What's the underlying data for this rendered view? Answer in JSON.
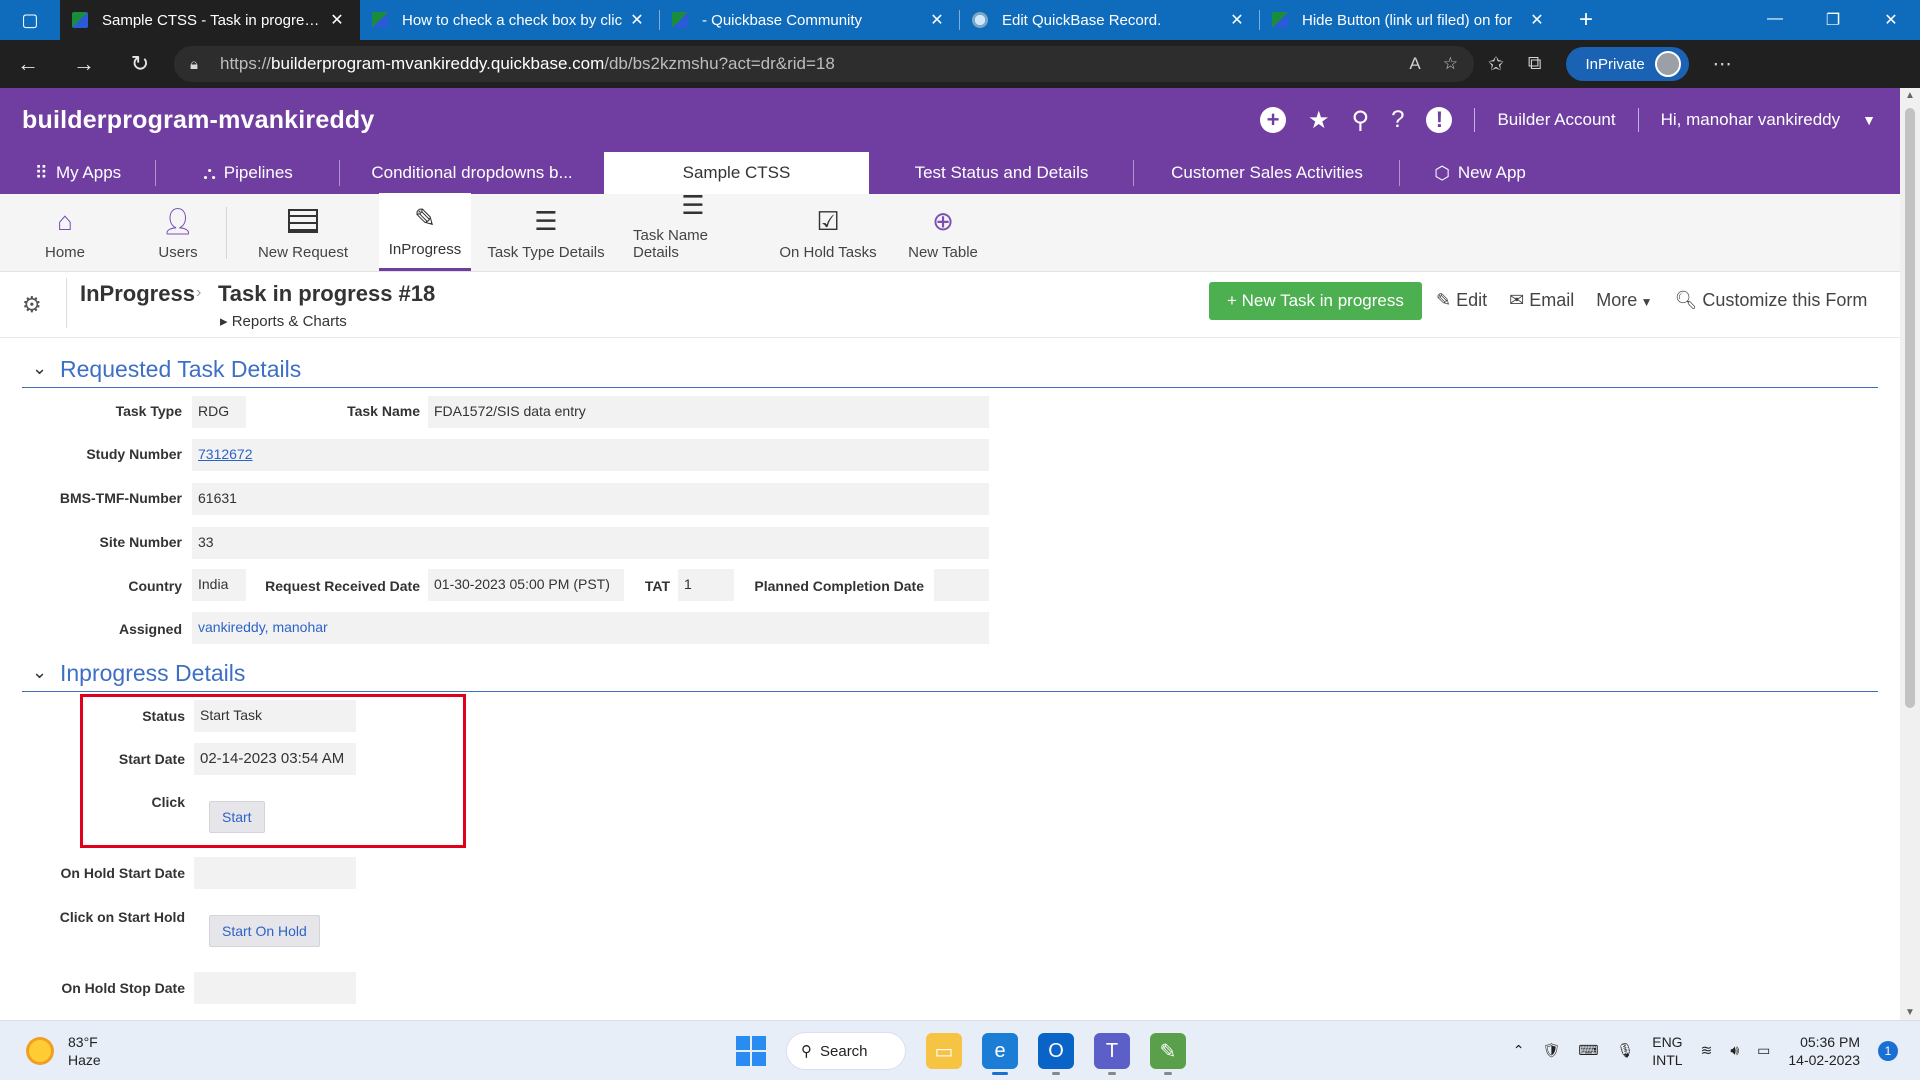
{
  "browser": {
    "tabs": [
      {
        "title": "Sample CTSS - Task in progress #",
        "active": true
      },
      {
        "title": "How to check a check box by clic",
        "active": false
      },
      {
        "title": "- Quickbase Community",
        "active": false
      },
      {
        "title": "Edit QuickBase Record.",
        "active": false
      },
      {
        "title": "Hide Button (link url filed) on for",
        "active": false
      }
    ],
    "url_scheme": "https://",
    "url_host": "builderprogram-mvankireddy.quickbase.com",
    "url_path": "/db/bs2kzmshu?act=dr&rid=18",
    "inprivate_label": "InPrivate"
  },
  "header": {
    "app_name": "builderprogram-mvankireddy",
    "builder_account": "Builder Account",
    "greeting": "Hi, manohar vankireddy"
  },
  "app_tabs": [
    {
      "label": "My Apps",
      "icon": "apps-grid-icon"
    },
    {
      "label": "Pipelines",
      "icon": "pipelines-icon"
    },
    {
      "label": "Conditional dropdowns b...",
      "icon": ""
    },
    {
      "label": "Sample CTSS",
      "icon": "",
      "active": true
    },
    {
      "label": "Test Status and Details",
      "icon": ""
    },
    {
      "label": "Customer Sales Activities",
      "icon": ""
    },
    {
      "label": "New App",
      "icon": "new-app-icon"
    }
  ],
  "tables": [
    {
      "label": "Home",
      "icon": "home-icon"
    },
    {
      "label": "Users",
      "icon": "users-icon"
    },
    {
      "label": "New Request",
      "icon": "table-icon"
    },
    {
      "label": "InProgress",
      "icon": "form-icon",
      "active": true
    },
    {
      "label": "Task Type Details",
      "icon": "list-icon"
    },
    {
      "label": "Task Name Details",
      "icon": "list-icon"
    },
    {
      "label": "On Hold Tasks",
      "icon": "checkbox-icon"
    },
    {
      "label": "New Table",
      "icon": "plus-circle-icon"
    }
  ],
  "page": {
    "breadcrumb_table": "InProgress",
    "record_title": "Task in progress #18",
    "reports_link": "Reports & Charts",
    "new_button": "+ New Task in progress",
    "edit": "Edit",
    "email": "Email",
    "more": "More",
    "customize": "Customize this Form"
  },
  "form": {
    "section1_title": "Requested Task Details",
    "task_type_label": "Task Type",
    "task_type": "RDG",
    "task_name_label": "Task Name",
    "task_name": "FDA1572/SIS data entry",
    "study_number_label": "Study Number",
    "study_number": "7312672",
    "bms_label": "BMS-TMF-Number",
    "bms": "61631",
    "site_label": "Site Number",
    "site": "33",
    "country_label": "Country",
    "country": "India",
    "received_label": "Request Received Date",
    "received": "01-30-2023 05:00 PM (PST)",
    "tat_label": "TAT",
    "tat": "1",
    "planned_label": "Planned Completion Date",
    "planned": "",
    "assigned_label": "Assigned",
    "assigned": "vankireddy, manohar",
    "section2_title": "Inprogress Details",
    "status_label": "Status",
    "status": "Start Task",
    "start_date_label": "Start Date",
    "start_date": "02-14-2023 03:54 AM",
    "click_label": "Click",
    "start_button": "Start",
    "onhold_start_label": "On Hold Start Date",
    "onhold_start": "",
    "click_hold_label": "Click on Start Hold",
    "start_hold_button": "Start On Hold",
    "onhold_stop_label": "On Hold Stop Date",
    "onhold_stop": ""
  },
  "taskbar": {
    "temperature": "83°F",
    "weather": "Haze",
    "search": "Search",
    "lang1": "ENG",
    "lang2": "INTL",
    "time": "05:36 PM",
    "date": "14-02-2023",
    "notifications": "1"
  }
}
